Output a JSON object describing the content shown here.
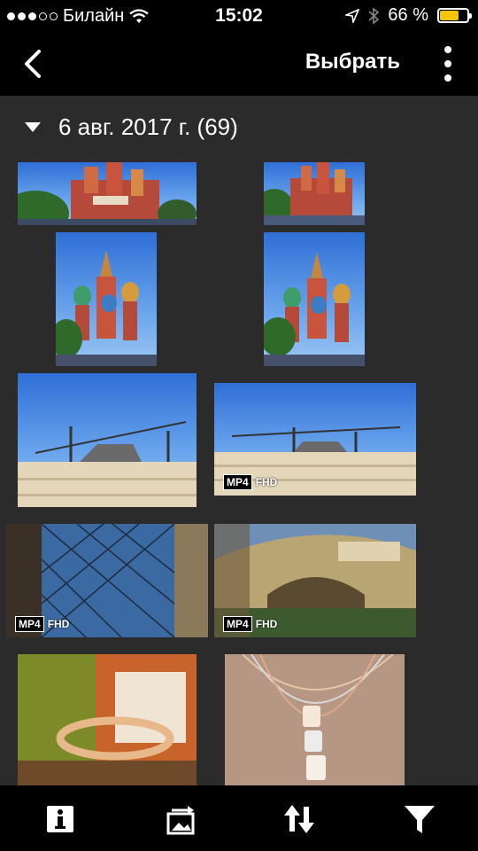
{
  "status_bar": {
    "carrier": "Билайн",
    "time": "15:02",
    "battery": "66 %",
    "battery_color": "#f5c400"
  },
  "header": {
    "back_icon": "chevron-left-icon",
    "select_label": "Выбрать",
    "more_icon": "more-vertical-icon"
  },
  "section": {
    "title": "6 авг. 2017 г. (69)"
  },
  "photos": [
    {
      "subject": "cathedral",
      "video": false
    },
    {
      "subject": "cathedral",
      "video": false
    },
    {
      "subject": "cathedral",
      "video": false
    },
    {
      "subject": "cathedral",
      "video": false
    },
    {
      "subject": "gum-building",
      "video": false
    },
    {
      "subject": "gum-building",
      "video": true
    },
    {
      "subject": "glass-roof",
      "video": true
    },
    {
      "subject": "gallery-interior",
      "video": true
    },
    {
      "subject": "ring",
      "video": false
    },
    {
      "subject": "necklace",
      "video": false
    }
  ],
  "video_badge": {
    "format": "MP4",
    "quality": "FHD"
  },
  "toolbar": {
    "icons": [
      "info-icon",
      "slideshow-icon",
      "sort-icon",
      "filter-icon"
    ]
  }
}
